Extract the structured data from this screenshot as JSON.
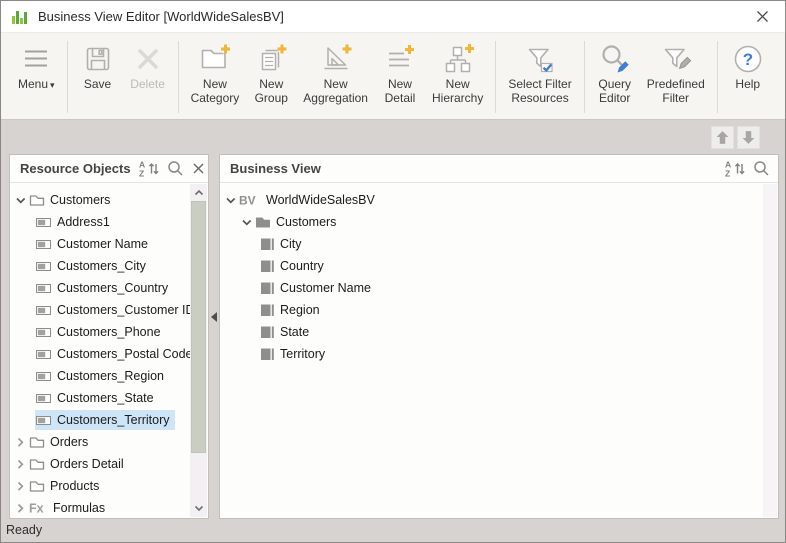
{
  "window": {
    "title": "Business View Editor [WorldWideSalesBV]"
  },
  "toolbar": {
    "groups": [
      [
        {
          "id": "menu",
          "lines": [
            "Menu"
          ],
          "icon": "menu-icon",
          "dropdown": true
        }
      ],
      [
        {
          "id": "save",
          "lines": [
            "Save"
          ],
          "icon": "save-icon"
        },
        {
          "id": "delete",
          "lines": [
            "Delete"
          ],
          "icon": "delete-icon",
          "disabled": true
        }
      ],
      [
        {
          "id": "new-category",
          "lines": [
            "New",
            "Category"
          ],
          "icon": "new-category-icon"
        },
        {
          "id": "new-group",
          "lines": [
            "New",
            "Group"
          ],
          "icon": "new-group-icon"
        },
        {
          "id": "new-aggregation",
          "lines": [
            "New",
            "Aggregation"
          ],
          "icon": "new-aggregation-icon"
        },
        {
          "id": "new-detail",
          "lines": [
            "New",
            "Detail"
          ],
          "icon": "new-detail-icon"
        },
        {
          "id": "new-hierarchy",
          "lines": [
            "New",
            "Hierarchy"
          ],
          "icon": "new-hierarchy-icon"
        }
      ],
      [
        {
          "id": "select-filter-resources",
          "lines": [
            "Select Filter",
            "Resources"
          ],
          "icon": "select-filter-icon"
        }
      ],
      [
        {
          "id": "query-editor",
          "lines": [
            "Query",
            "Editor"
          ],
          "icon": "query-editor-icon"
        },
        {
          "id": "predefined-filter",
          "lines": [
            "Predefined",
            "Filter"
          ],
          "icon": "predefined-filter-icon"
        }
      ],
      [
        {
          "id": "help",
          "lines": [
            "Help"
          ],
          "icon": "help-icon"
        }
      ]
    ]
  },
  "nav_buttons": {
    "up": "up-arrow-icon",
    "down": "down-arrow-icon"
  },
  "left_panel": {
    "title": "Resource Objects",
    "header_icons": [
      "az-sort-icon",
      "search-icon",
      "close-icon"
    ],
    "tree": [
      {
        "label": "Customers",
        "icon": "folder-open-icon",
        "chevron": "down",
        "level": 0
      },
      {
        "label": "Address1",
        "icon": "field-icon",
        "level": 1
      },
      {
        "label": "Customer Name",
        "icon": "field-icon",
        "level": 1
      },
      {
        "label": "Customers_City",
        "icon": "field-icon",
        "level": 1
      },
      {
        "label": "Customers_Country",
        "icon": "field-icon",
        "level": 1
      },
      {
        "label": "Customers_Customer ID",
        "icon": "field-icon",
        "level": 1
      },
      {
        "label": "Customers_Phone",
        "icon": "field-icon",
        "level": 1
      },
      {
        "label": "Customers_Postal Code",
        "icon": "field-icon",
        "level": 1
      },
      {
        "label": "Customers_Region",
        "icon": "field-icon",
        "level": 1
      },
      {
        "label": "Customers_State",
        "icon": "field-icon",
        "level": 1
      },
      {
        "label": "Customers_Territory",
        "icon": "field-icon",
        "level": 1,
        "selected": true
      },
      {
        "label": "Orders",
        "icon": "folder-closed-icon",
        "chevron": "right",
        "level": 0
      },
      {
        "label": "Orders Detail",
        "icon": "folder-closed-icon",
        "chevron": "right",
        "level": 0
      },
      {
        "label": "Products",
        "icon": "folder-closed-icon",
        "chevron": "right",
        "level": 0
      },
      {
        "label": "Formulas",
        "icon": "formula-icon",
        "chevron": "right",
        "level": 0
      }
    ]
  },
  "right_panel": {
    "title": "Business View",
    "header_icons": [
      "az-sort-icon",
      "search-icon"
    ],
    "tree": [
      {
        "label": "WorldWideSalesBV",
        "icon": "business-view-icon",
        "chevron": "down",
        "level": 0
      },
      {
        "label": "Customers",
        "icon": "group-folder-icon",
        "chevron": "down",
        "level": 1
      },
      {
        "label": "City",
        "icon": "detail-object-icon",
        "level": 2
      },
      {
        "label": "Country",
        "icon": "detail-object-icon",
        "level": 2
      },
      {
        "label": "Customer Name",
        "icon": "detail-object-icon",
        "level": 2
      },
      {
        "label": "Region",
        "icon": "detail-object-icon",
        "level": 2
      },
      {
        "label": "State",
        "icon": "detail-object-icon",
        "level": 2
      },
      {
        "label": "Territory",
        "icon": "detail-object-icon",
        "level": 2
      }
    ]
  },
  "statusbar": {
    "text": "Ready"
  },
  "colors": {
    "selection": "#cde5f7",
    "accent_yellow": "#f2b63c",
    "accent_blue": "#3d7fd0",
    "icon_gray": "#b2b0ad",
    "dark_gray": "#8f8d8a",
    "logo_green_light": "#8dc63f",
    "logo_green_dark": "#5aa83c"
  }
}
